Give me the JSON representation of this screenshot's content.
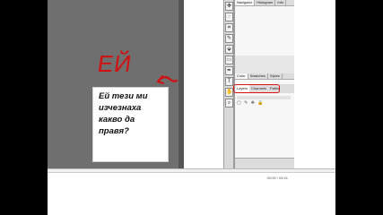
{
  "overlay": {
    "shout": "ЕЙ",
    "note_text": "Ей тези ми\nизчезнаха\nкакво да\nправя?"
  },
  "top_panel": {
    "tabs": [
      "Navigator",
      "Histogram",
      "Info"
    ]
  },
  "mid_panel": {
    "tabs": [
      "Color",
      "Swatches",
      "Styles"
    ]
  },
  "layers_panel": {
    "tabs": [
      "Layers",
      "Channels",
      "Paths"
    ]
  },
  "status": {
    "time": "00:00 / 04:51"
  },
  "colors": {
    "canvas": "#6f6f6f",
    "annotation_red": "#d31010",
    "panel": "#f1f1f1"
  }
}
